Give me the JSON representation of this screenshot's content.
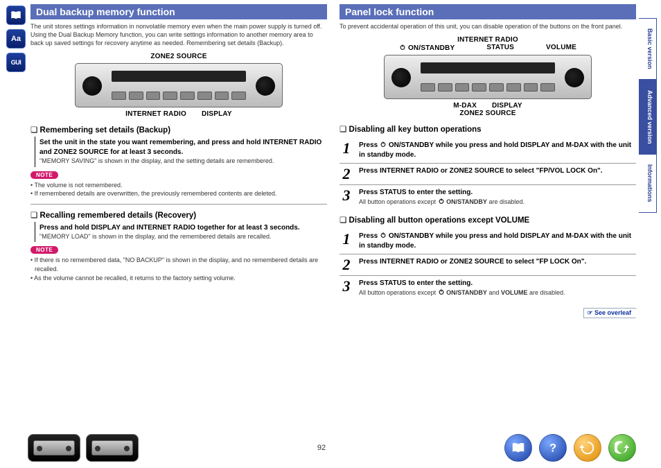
{
  "page_number": "92",
  "left_rail": {
    "items": [
      "book-icon",
      "aa-icon",
      "gui-icon"
    ]
  },
  "right_rail": {
    "tabs": [
      {
        "label": "Basic version",
        "active": false
      },
      {
        "label": "Advanced version",
        "active": true
      },
      {
        "label": "Informations",
        "active": false
      }
    ]
  },
  "see_overleaf": "See overleaf",
  "col_left": {
    "title": "Dual backup memory function",
    "intro": "The unit stores settings information in nonvolatile memory even when the main power supply is turned off. Using the Dual Backup Memory function, you can write settings information to another memory area to back up saved settings for recovery anytime as needed. Remembering set details (Backup).",
    "diagram": {
      "top": [
        "ZONE2 SOURCE"
      ],
      "bottom": [
        "INTERNET RADIO",
        "DISPLAY"
      ]
    },
    "sub1": {
      "heading": "Remembering set details (Backup)",
      "body_bold": "Set the unit in the state you want remembering, and press and hold INTERNET RADIO and ZONE2 SOURCE for at least 3 seconds.",
      "body_sub": "\"MEMORY SAVING\" is shown in the display, and the setting details are remembered."
    },
    "note1": {
      "label": "NOTE",
      "bullets": [
        "The volume is not remembered.",
        "If remembered details are overwritten, the previously remembered contents are deleted."
      ]
    },
    "sub2": {
      "heading": "Recalling remembered details (Recovery)",
      "body_bold": "Press and hold DISPLAY and INTERNET RADIO together for at least 3 seconds.",
      "body_sub": "\"MEMORY LOAD\" is shown in the display, and the remembered details are recalled."
    },
    "note2": {
      "label": "NOTE",
      "bullets": [
        "If there is no remembered data, \"NO BACKUP\" is shown in the display, and no remembered details are recalled.",
        "As the volume cannot be recalled, it returns to the factory setting volume."
      ]
    }
  },
  "col_right": {
    "title": "Panel lock function",
    "intro": "To prevent accidental operation of this unit, you can disable operation of the buttons on the front panel.",
    "diagram": {
      "top_center": "INTERNET RADIO",
      "top_row": [
        "ON/STANDBY",
        "STATUS",
        "VOLUME"
      ],
      "bottom_row": [
        "M-DAX",
        "DISPLAY"
      ],
      "bottom_center": "ZONE2 SOURCE"
    },
    "group1": {
      "heading": "Disabling all key button operations",
      "steps": [
        {
          "num": "1",
          "bold_parts": {
            "pre": "Press ",
            "kw1": "ON/STANDBY",
            "mid1": " while you press and hold ",
            "kw2": "DISPLAY",
            "mid2": " and ",
            "kw3": "M-DAX",
            "post": " with the unit in standby mode."
          }
        },
        {
          "num": "2",
          "bold": "Press INTERNET RADIO or ZONE2 SOURCE to select \"FP/VOL LOCK On\"."
        },
        {
          "num": "3",
          "bold": "Press STATUS to enter the setting.",
          "sub_parts": {
            "pre": "All button operations except ",
            "kw": "ON/STANDBY",
            "post": " are disabled."
          }
        }
      ]
    },
    "group2": {
      "heading": "Disabling all button operations except VOLUME",
      "steps": [
        {
          "num": "1",
          "bold_parts": {
            "pre": "Press ",
            "kw1": "ON/STANDBY",
            "mid1": " while you press and hold ",
            "kw2": "DISPLAY",
            "mid2": " and ",
            "kw3": "M-DAX",
            "post": " with the unit in standby mode."
          }
        },
        {
          "num": "2",
          "bold": "Press INTERNET RADIO or ZONE2 SOURCE to select \"FP LOCK On\"."
        },
        {
          "num": "3",
          "bold": "Press STATUS to enter the setting.",
          "sub_parts": {
            "pre": "All button operations except ",
            "kw": "ON/STANDBY",
            "mid": " and ",
            "kw2": "VOLUME",
            "post": " are disabled."
          }
        }
      ]
    }
  }
}
